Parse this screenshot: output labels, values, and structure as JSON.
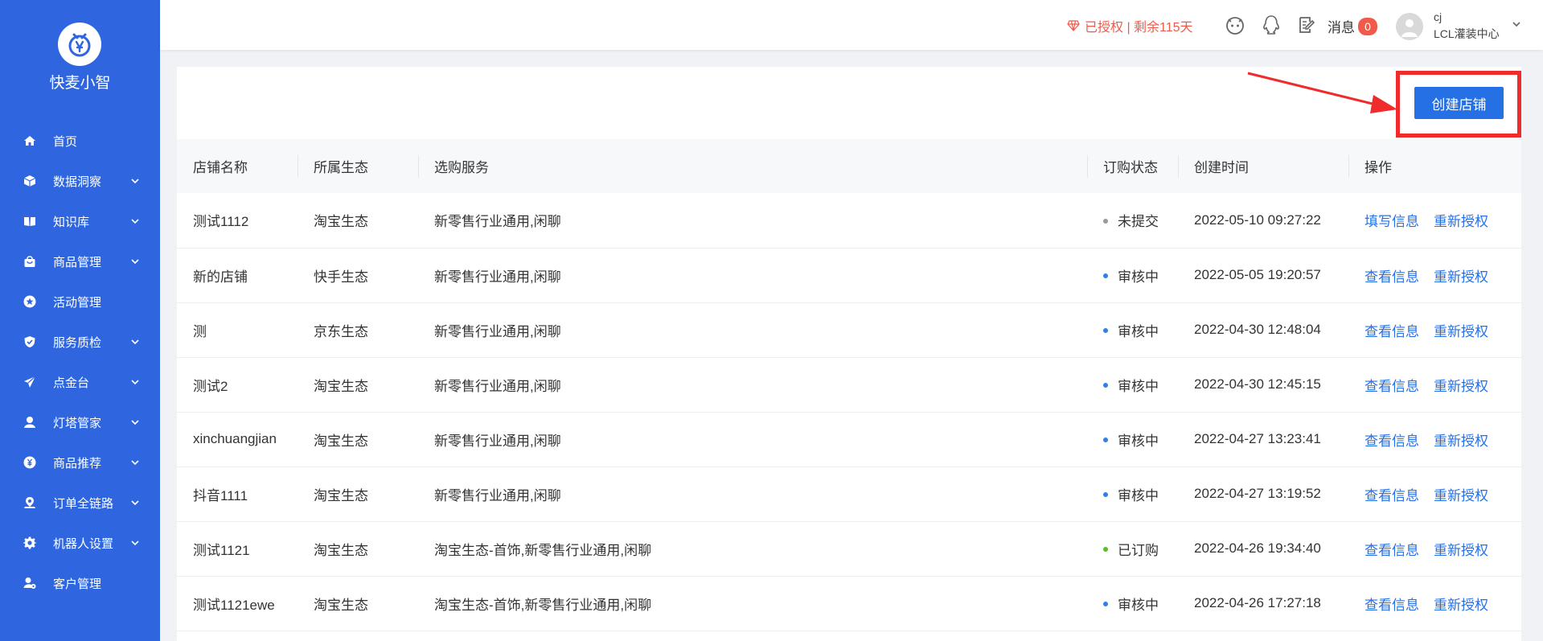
{
  "app": {
    "name": "快麦小智"
  },
  "sidebar": {
    "items": [
      {
        "label": "首页",
        "icon": "home-icon",
        "expandable": false
      },
      {
        "label": "数据洞察",
        "icon": "cube-icon",
        "expandable": true
      },
      {
        "label": "知识库",
        "icon": "book-icon",
        "expandable": true
      },
      {
        "label": "商品管理",
        "icon": "shopping-bag-icon",
        "expandable": true
      },
      {
        "label": "活动管理",
        "icon": "star-icon",
        "expandable": false
      },
      {
        "label": "服务质检",
        "icon": "shield-check-icon",
        "expandable": true
      },
      {
        "label": "点金台",
        "icon": "paper-plane-icon",
        "expandable": true
      },
      {
        "label": "灯塔管家",
        "icon": "person-icon",
        "expandable": true
      },
      {
        "label": "商品推荐",
        "icon": "yen-coin-icon",
        "expandable": true
      },
      {
        "label": "订单全链路",
        "icon": "location-pin-icon",
        "expandable": true
      },
      {
        "label": "机器人设置",
        "icon": "gear-icon",
        "expandable": true
      },
      {
        "label": "客户管理",
        "icon": "user-settings-icon",
        "expandable": false
      }
    ]
  },
  "header": {
    "auth_status": "已授权 | 剩余115天",
    "messages_label": "消息",
    "messages_count": "0",
    "user_name": "cj",
    "user_org": "LCL灌装中心"
  },
  "toolbar": {
    "create_label": "创建店铺"
  },
  "table": {
    "columns": [
      "店铺名称",
      "所属生态",
      "选购服务",
      "订购状态",
      "创建时间",
      "操作"
    ],
    "rows": [
      {
        "name": "测试1112",
        "eco": "淘宝生态",
        "service": "新零售行业通用,闲聊",
        "status": "未提交",
        "status_color": "#999999",
        "time": "2022-05-10 09:27:22",
        "action1": "填写信息",
        "action2": "重新授权"
      },
      {
        "name": "新的店铺",
        "eco": "快手生态",
        "service": "新零售行业通用,闲聊",
        "status": "审核中",
        "status_color": "#2f80ed",
        "time": "2022-05-05 19:20:57",
        "action1": "查看信息",
        "action2": "重新授权"
      },
      {
        "name": "测",
        "eco": "京东生态",
        "service": "新零售行业通用,闲聊",
        "status": "审核中",
        "status_color": "#2f80ed",
        "time": "2022-04-30 12:48:04",
        "action1": "查看信息",
        "action2": "重新授权"
      },
      {
        "name": "测试2",
        "eco": "淘宝生态",
        "service": "新零售行业通用,闲聊",
        "status": "审核中",
        "status_color": "#2f80ed",
        "time": "2022-04-30 12:45:15",
        "action1": "查看信息",
        "action2": "重新授权"
      },
      {
        "name": "xinchuangjian",
        "eco": "淘宝生态",
        "service": "新零售行业通用,闲聊",
        "status": "审核中",
        "status_color": "#2f80ed",
        "time": "2022-04-27 13:23:41",
        "action1": "查看信息",
        "action2": "重新授权"
      },
      {
        "name": "抖音1111",
        "eco": "淘宝生态",
        "service": "新零售行业通用,闲聊",
        "status": "审核中",
        "status_color": "#2f80ed",
        "time": "2022-04-27 13:19:52",
        "action1": "查看信息",
        "action2": "重新授权"
      },
      {
        "name": "测试1121",
        "eco": "淘宝生态",
        "service": "淘宝生态-首饰,新零售行业通用,闲聊",
        "status": "已订购",
        "status_color": "#52c41a",
        "time": "2022-04-26 19:34:40",
        "action1": "查看信息",
        "action2": "重新授权"
      },
      {
        "name": "测试1121ewe",
        "eco": "淘宝生态",
        "service": "淘宝生态-首饰,新零售行业通用,闲聊",
        "status": "审核中",
        "status_color": "#2f80ed",
        "time": "2022-04-26 17:27:18",
        "action1": "查看信息",
        "action2": "重新授权"
      }
    ]
  },
  "colors": {
    "sidebar_bg": "#2f66e0",
    "primary": "#2670e6",
    "highlight": "#ef2b2b",
    "auth_text": "#f05a4a"
  }
}
